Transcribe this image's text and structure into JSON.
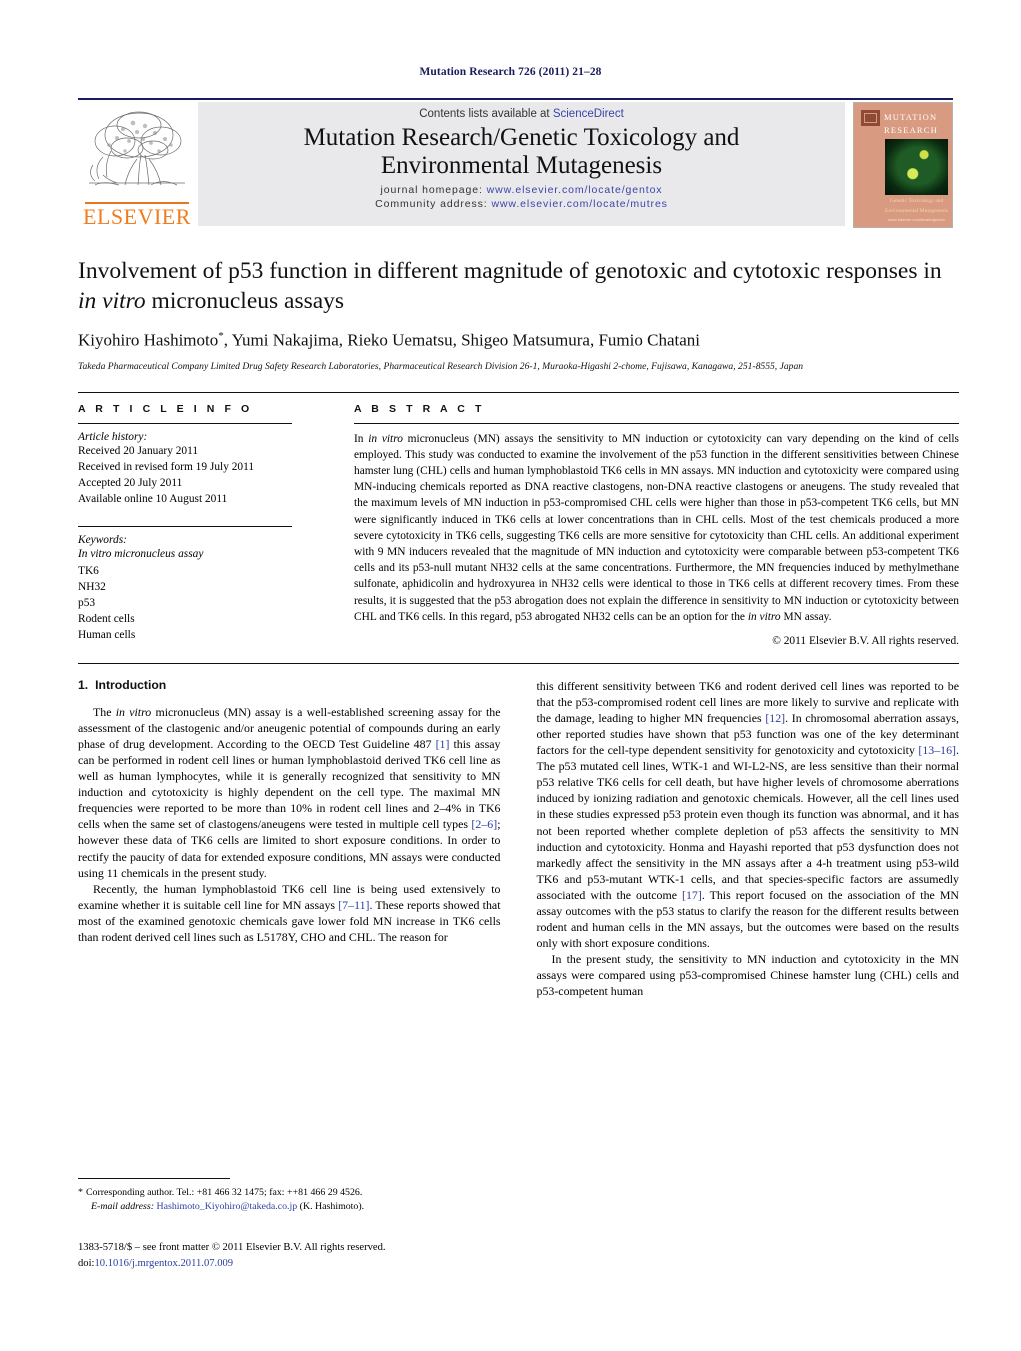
{
  "running_head": "Mutation Research 726 (2011) 21–28",
  "masthead": {
    "contents_prefix": "Contents lists available at ",
    "sciencedirect": "ScienceDirect",
    "journal_title_line1": "Mutation Research/Genetic Toxicology and",
    "journal_title_line2": "Environmental Mutagenesis",
    "homepage_label": "journal homepage:",
    "homepage_url": "www.elsevier.com/locate/gentox",
    "community_label": "Community address:",
    "community_url": "www.elsevier.com/locate/mutres",
    "publisher_logo_text": "ELSEVIER",
    "cover_title_line1": "MUTATION",
    "cover_title_line2": "RESEARCH",
    "cover_subtitle_line1": "Genetic Toxicology and",
    "cover_subtitle_line2": "Environmental Mutagenesis",
    "cover_url": "www.elsevier.com/locate/gentox"
  },
  "article": {
    "title_part1": "Involvement of p53 function in different magnitude of genotoxic and cytotoxic responses in ",
    "title_italic": "in vitro",
    "title_part2": " micronucleus assays",
    "authors": "Kiyohiro Hashimoto",
    "authors_rest": ", Yumi Nakajima, Rieko Uematsu, Shigeo Matsumura, Fumio Chatani",
    "author_marker": "*",
    "affiliation": "Takeda Pharmaceutical Company Limited Drug Safety Research Laboratories, Pharmaceutical Research Division 26-1, Muraoka-Higashi 2-chome, Fujisawa, Kanagawa, 251-8555, Japan"
  },
  "article_info": {
    "heading": "A R T I C L E   I N F O",
    "history_label": "Article history:",
    "history": [
      "Received 20 January 2011",
      "Received in revised form 19 July 2011",
      "Accepted 20 July 2011",
      "Available online 10 August 2011"
    ],
    "keywords_label": "Keywords:",
    "keywords": [
      "In vitro micronucleus assay",
      "TK6",
      "NH32",
      "p53",
      "Rodent cells",
      "Human cells"
    ]
  },
  "abstract": {
    "heading": "A B S T R A C T",
    "lead_in": "In ",
    "lead_italic": "in vitro",
    "text": " micronucleus (MN) assays the sensitivity to MN induction or cytotoxicity can vary depending on the kind of cells employed. This study was conducted to examine the involvement of the p53 function in the different sensitivities between Chinese hamster lung (CHL) cells and human lymphoblastoid TK6 cells in MN assays. MN induction and cytotoxicity were compared using MN-inducing chemicals reported as DNA reactive clastogens, non-DNA reactive clastogens or aneugens. The study revealed that the maximum levels of MN induction in p53-compromised CHL cells were higher than those in p53-competent TK6 cells, but MN were significantly induced in TK6 cells at lower concentrations than in CHL cells. Most of the test chemicals produced a more severe cytotoxicity in TK6 cells, suggesting TK6 cells are more sensitive for cytotoxicity than CHL cells. An additional experiment with 9 MN inducers revealed that the magnitude of MN induction and cytotoxicity were comparable between p53-competent TK6 cells and its p53-null mutant NH32 cells at the same concentrations. Furthermore, the MN frequencies induced by methylmethane sulfonate, aphidicolin and hydroxyurea in NH32 cells were identical to those in TK6 cells at different recovery times. From these results, it is suggested that the p53 abrogation does not explain the difference in sensitivity to MN induction or cytotoxicity between CHL and TK6 cells. In this regard, p53 abrogated NH32 cells can be an option for the ",
    "tail_italic": "in vitro",
    "tail_text": " MN assay.",
    "copyright": "© 2011 Elsevier B.V. All rights reserved."
  },
  "body": {
    "section_number": "1.",
    "section_title": "Introduction",
    "left_p1_a": "The ",
    "left_p1_italic": "in vitro",
    "left_p1_b": " micronucleus (MN) assay is a well-established screening assay for the assessment of the clastogenic and/or aneugenic potential of compounds during an early phase of drug development. According to the OECD Test Guideline 487 ",
    "left_p1_ref1": "[1]",
    "left_p1_c": " this assay can be performed in rodent cell lines or human lymphoblastoid derived TK6 cell line as well as human lymphocytes, while it is generally recognized that sensitivity to MN induction and cytotoxicity is highly dependent on the cell type. The maximal MN frequencies were reported to be more than 10% in rodent cell lines and 2–4% in TK6 cells when the same set of clastogens/aneugens were tested in multiple cell types ",
    "left_p1_ref2": "[2–6]",
    "left_p1_d": "; however these data of TK6 cells are limited to short exposure conditions. In order to rectify the paucity of data for extended exposure conditions, MN assays were conducted using 11 chemicals in the present study.",
    "left_p2_a": "Recently, the human lymphoblastoid TK6 cell line is being used extensively to examine whether it is suitable cell line for MN assays ",
    "left_p2_ref": "[7–11]",
    "left_p2_b": ". These reports showed that most of the examined genotoxic chemicals gave lower fold MN increase in TK6 cells than rodent derived cell lines such as L5178Y, CHO and CHL. The reason for",
    "right_p1_a": "this different sensitivity between TK6 and rodent derived cell lines was reported to be that the p53-compromised rodent cell lines are more likely to survive and replicate with the damage, leading to higher MN frequencies ",
    "right_p1_ref1": "[12]",
    "right_p1_b": ". In chromosomal aberration assays, other reported studies have shown that p53 function was one of the key determinant factors for the cell-type dependent sensitivity for genotoxicity and cytotoxicity ",
    "right_p1_ref2": "[13–16]",
    "right_p1_c": ". The p53 mutated cell lines, WTK-1 and WI-L2-NS, are less sensitive than their normal p53 relative TK6 cells for cell death, but have higher levels of chromosome aberrations induced by ionizing radiation and genotoxic chemicals. However, all the cell lines used in these studies expressed p53 protein even though its function was abnormal, and it has not been reported whether complete depletion of p53 affects the sensitivity to MN induction and cytotoxicity. Honma and Hayashi reported that p53 dysfunction does not markedly affect the sensitivity in the MN assays after a 4-h treatment using p53-wild TK6 and p53-mutant WTK-1 cells, and that species-specific factors are assumedly associated with the outcome ",
    "right_p1_ref3": "[17]",
    "right_p1_d": ". This report focused on the association of the MN assay outcomes with the p53 status to clarify the reason for the different results between rodent and human cells in the MN assays, but the outcomes were based on the results only with short exposure conditions.",
    "right_p2": "In the present study, the sensitivity to MN induction and cytotoxicity in the MN assays were compared using p53-compromised Chinese hamster lung (CHL) cells and p53-competent human"
  },
  "footnote": {
    "star": "*",
    "corresponding": "Corresponding author. Tel.: +81 466 32 1475; fax: ++81 466 29 4526.",
    "email_label": "E-mail address:",
    "email": "Hashimoto_Kiyohiro@takeda.co.jp",
    "email_suffix": "(K. Hashimoto).",
    "issn_line": "1383-5718/$ – see front matter © 2011 Elsevier B.V. All rights reserved.",
    "doi_label": "doi:",
    "doi": "10.1016/j.mrgentox.2011.07.009"
  },
  "colors": {
    "link_blue": "#2a3fa0",
    "header_navy": "#1a1a5e",
    "elsevier_orange": "#f07c1e",
    "band_gray": "#e9e9ec"
  }
}
